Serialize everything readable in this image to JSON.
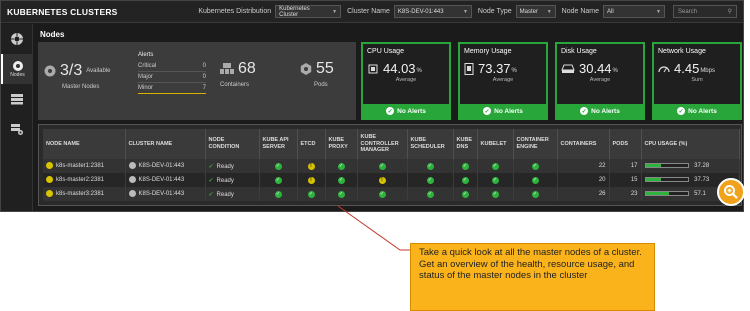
{
  "header": {
    "title": "KUBERNETES CLUSTERS",
    "distribution_label": "Kubernetes Distribution",
    "distribution_value": "Kubernetes Cluster",
    "cluster_label": "Cluster Name",
    "cluster_value": "K8S-DEV-01:443",
    "nodetype_label": "Node Type",
    "nodetype_value": "Master",
    "nodename_label": "Node Name",
    "nodename_value": "All",
    "search_placeholder": "Search"
  },
  "sidebar": {
    "items": [
      {
        "label": ""
      },
      {
        "label": "Nodes"
      },
      {
        "label": ""
      },
      {
        "label": ""
      }
    ]
  },
  "section": {
    "title": "Nodes"
  },
  "summary": {
    "master_count": "3/3",
    "master_available": "Available",
    "master_label": "Master Nodes",
    "alerts_title": "Alerts",
    "alerts": [
      {
        "label": "Critical",
        "value": "0"
      },
      {
        "label": "Major",
        "value": "0"
      },
      {
        "label": "Minor",
        "value": "7"
      }
    ],
    "containers_value": "68",
    "containers_label": "Containers",
    "pods_value": "55",
    "pods_label": "Pods"
  },
  "cards": [
    {
      "title": "CPU Usage",
      "value": "44.03",
      "unit": "%",
      "sub": "Average",
      "footer": "No Alerts"
    },
    {
      "title": "Memory Usage",
      "value": "73.37",
      "unit": "%",
      "sub": "Average",
      "footer": "No Alerts"
    },
    {
      "title": "Disk Usage",
      "value": "30.44",
      "unit": "%",
      "sub": "Average",
      "footer": "No Alerts"
    },
    {
      "title": "Network Usage",
      "value": "4.45",
      "unit": "Mbps",
      "sub": "Sum",
      "footer": "No Alerts"
    }
  ],
  "table": {
    "headers": [
      "NODE NAME",
      "CLUSTER NAME",
      "NODE CONDITION",
      "KUBE API SERVER",
      "ETCD",
      "KUBE PROXY",
      "KUBE CONTROLLER MANAGER",
      "KUBE SCHEDULER",
      "KUBE DNS",
      "KUBELET",
      "CONTAINER ENGINE",
      "CONTAINERS",
      "PODS",
      "CPU USAGE (%)"
    ],
    "rows": [
      {
        "node": "k8s-master1:2381",
        "cluster": "K8S-DEV-01:443",
        "condition": "Ready",
        "containers": "22",
        "pods": "17",
        "cpu": "37.28",
        "cpu_pct": 37.28,
        "status": [
          "ok",
          "warn",
          "ok",
          "ok",
          "ok",
          "ok",
          "ok",
          "ok"
        ]
      },
      {
        "node": "k8s-master2:2381",
        "cluster": "K8S-DEV-01:443",
        "condition": "Ready",
        "containers": "20",
        "pods": "15",
        "cpu": "37.73",
        "cpu_pct": 37.73,
        "status": [
          "ok",
          "warn",
          "ok",
          "warn",
          "ok",
          "ok",
          "ok",
          "ok"
        ]
      },
      {
        "node": "k8s-master3:2381",
        "cluster": "K8S-DEV-01:443",
        "condition": "Ready",
        "containers": "26",
        "pods": "23",
        "cpu": "57.1",
        "cpu_pct": 57.1,
        "status": [
          "ok",
          "ok",
          "ok",
          "ok",
          "ok",
          "ok",
          "ok",
          "ok"
        ]
      }
    ]
  },
  "callout": {
    "text": "Take a quick look at all the master nodes of a cluster. Get an overview of the health, resource usage, and status of the master nodes in the cluster"
  },
  "colors": {
    "ok": "#2fb33e",
    "warn": "#d6c300",
    "callout": "#fbb31c",
    "zoom": "#f0a21a"
  }
}
